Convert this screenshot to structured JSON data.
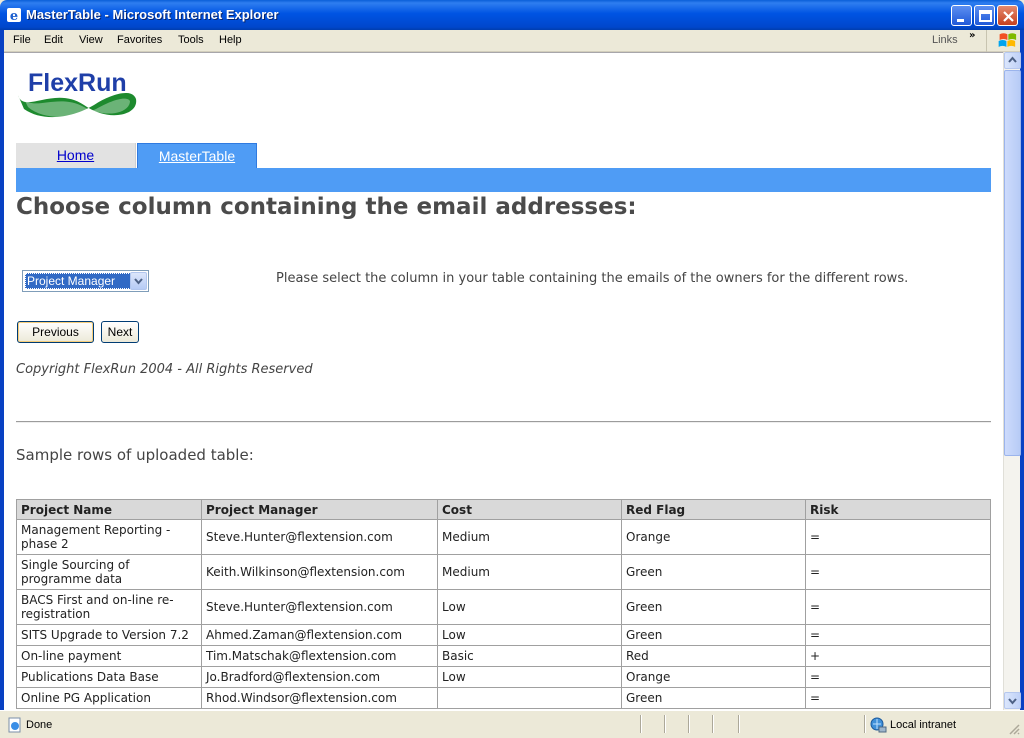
{
  "window": {
    "title": "MasterTable - Microsoft Internet Explorer",
    "minimize_icon": "minimize-icon",
    "maximize_icon": "maximize-icon",
    "close_icon": "close-icon"
  },
  "menu": {
    "items": [
      "File",
      "Edit",
      "View",
      "Favorites",
      "Tools",
      "Help"
    ],
    "links_label": "Links",
    "chevron": "»"
  },
  "page": {
    "logo_text": "FlexRun",
    "tabs": [
      {
        "label": "Home",
        "active": false
      },
      {
        "label": "MasterTable",
        "active": true
      }
    ],
    "heading": "Choose column containing the email addresses:",
    "select_value": "Project Manager",
    "instruction": "Please select the column in your table containing the emails of the owners for the different rows.",
    "buttons": {
      "previous": "Previous",
      "next": "Next"
    },
    "copyright": "Copyright FlexRun 2004 - All Rights Reserved",
    "sample_heading": "Sample rows of uploaded table:"
  },
  "table": {
    "headers": [
      "Project Name",
      "Project Manager",
      "Cost",
      "Red Flag",
      "Risk"
    ],
    "rows": [
      [
        "Management Reporting - phase 2",
        "Steve.Hunter@flextension.com",
        "Medium",
        "Orange",
        "="
      ],
      [
        "Single Sourcing of programme data",
        "Keith.Wilkinson@flextension.com",
        "Medium",
        "Green",
        "="
      ],
      [
        "BACS First and on-line re-registration",
        "Steve.Hunter@flextension.com",
        "Low",
        "Green",
        "="
      ],
      [
        "SITS Upgrade to Version 7.2",
        "Ahmed.Zaman@flextension.com",
        "Low",
        "Green",
        "="
      ],
      [
        "On-line payment",
        "Tim.Matschak@flextension.com",
        "Basic",
        "Red",
        "+"
      ],
      [
        "Publications Data Base",
        "Jo.Bradford@flextension.com",
        "Low",
        "Orange",
        "="
      ],
      [
        "Online PG Application",
        "Rhod.Windsor@flextension.com",
        "",
        "Green",
        "="
      ]
    ]
  },
  "status": {
    "text": "Done",
    "zone": "Local intranet"
  },
  "colors": {
    "titlebar": "#0054e3",
    "tab_active": "#4f9cf5",
    "link": "#0000cc",
    "heading": "#4b4b4b"
  }
}
